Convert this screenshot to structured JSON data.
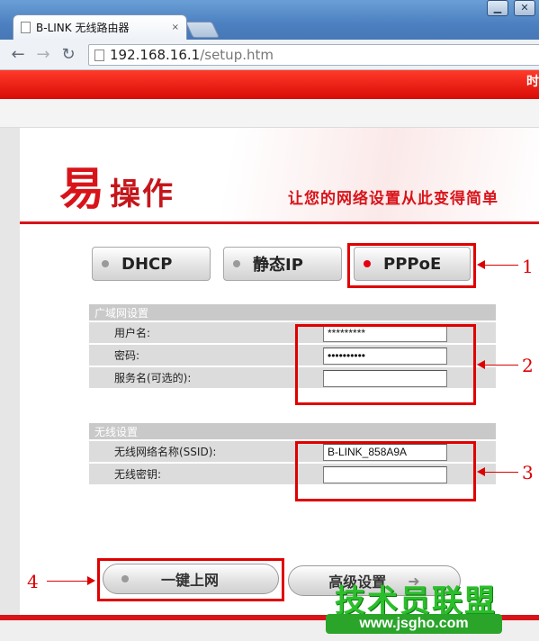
{
  "browser": {
    "tab_title": "B-LINK 无线路由器",
    "tab_close": "×",
    "url_host": "192.168.16.1",
    "url_path": "/setup.htm",
    "win_minimize": "▁",
    "win_close": "✕"
  },
  "page": {
    "banner_edge_text": "时",
    "logo_char": "易",
    "logo_text": "操作",
    "slogan": "让您的网络设置从此变得简单"
  },
  "modes": [
    {
      "label": "DHCP",
      "selected": false
    },
    {
      "label": "静态IP",
      "selected": false
    },
    {
      "label": "PPPoE",
      "selected": true
    }
  ],
  "wan": {
    "title": "广域网设置",
    "username_label": "用户名:",
    "username_value": "*********",
    "password_label": "密码:",
    "password_value": "••••••••••",
    "service_label": "服务名(可选的):",
    "service_value": ""
  },
  "wireless": {
    "title": "无线设置",
    "ssid_label": "无线网络名称(SSID):",
    "ssid_value": "B-LINK_858A9A",
    "key_label": "无线密钥:",
    "key_value": ""
  },
  "actions": {
    "connect_label": "一键上网",
    "advanced_label": "高级设置"
  },
  "annotations": [
    "1",
    "2",
    "3",
    "4"
  ],
  "watermark": {
    "text": "技术员联盟",
    "url": "www.jsgho.com"
  },
  "colors": {
    "brand_red": "#d8141a",
    "annotation_red": "#e00000",
    "active_dot": "#e60012",
    "watermark_green": "#2bbf2b"
  }
}
